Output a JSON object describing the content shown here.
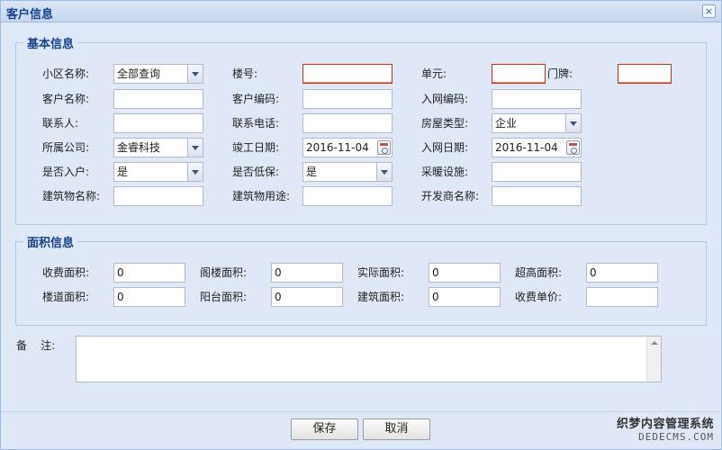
{
  "window": {
    "title": "客户信息",
    "close_glyph": "×"
  },
  "basic": {
    "legend": "基本信息",
    "community_label": "小区名称:",
    "community_value": "全部查询",
    "building_label": "楼号:",
    "building_value": "",
    "unit_label": "单元:",
    "unit_value": "",
    "door_label": "门牌:",
    "door_value": "",
    "customer_name_label": "客户名称:",
    "customer_name_value": "",
    "customer_code_label": "客户编码:",
    "customer_code_value": "",
    "network_code_label": "入网编码:",
    "network_code_value": "",
    "contact_label": "联系人:",
    "contact_value": "",
    "phone_label": "联系电话:",
    "phone_value": "",
    "house_type_label": "房屋类型:",
    "house_type_value": "企业",
    "company_label": "所属公司:",
    "company_value": "金睿科技",
    "completion_label": "竣工日期:",
    "completion_value": "2016-11-04",
    "network_date_label": "入网日期:",
    "network_date_value": "2016-11-04",
    "moved_in_label": "是否入户:",
    "moved_in_value": "是",
    "low_income_label": "是否低保:",
    "low_income_value": "是",
    "heating_label": "采暖设施:",
    "heating_value": "",
    "building_name_label": "建筑物名称:",
    "building_name_value": "",
    "building_use_label": "建筑物用途:",
    "building_use_value": "",
    "developer_label": "开发商名称:",
    "developer_value": ""
  },
  "area": {
    "legend": "面积信息",
    "charge_label": "收费面积:",
    "charge_value": "0",
    "attic_label": "阁楼面积:",
    "attic_value": "0",
    "actual_label": "实际面积:",
    "actual_value": "0",
    "extra_high_label": "超高面积:",
    "extra_high_value": "0",
    "stair_label": "楼道面积:",
    "stair_value": "0",
    "balcony_label": "阳台面积:",
    "balcony_value": "0",
    "construction_label": "建筑面积:",
    "construction_value": "0",
    "unit_price_label": "收费单价:",
    "unit_price_value": ""
  },
  "remark": {
    "label": "备    注:",
    "value": ""
  },
  "buttons": {
    "save": "保存",
    "cancel": "取消"
  },
  "watermark": {
    "line1": "织梦内容管理系统",
    "line2": "DEDECMS.COM"
  },
  "colors": {
    "title": "#15428b",
    "invalid_border": "#cc3300",
    "panel_bg": "#dfe8f6"
  }
}
